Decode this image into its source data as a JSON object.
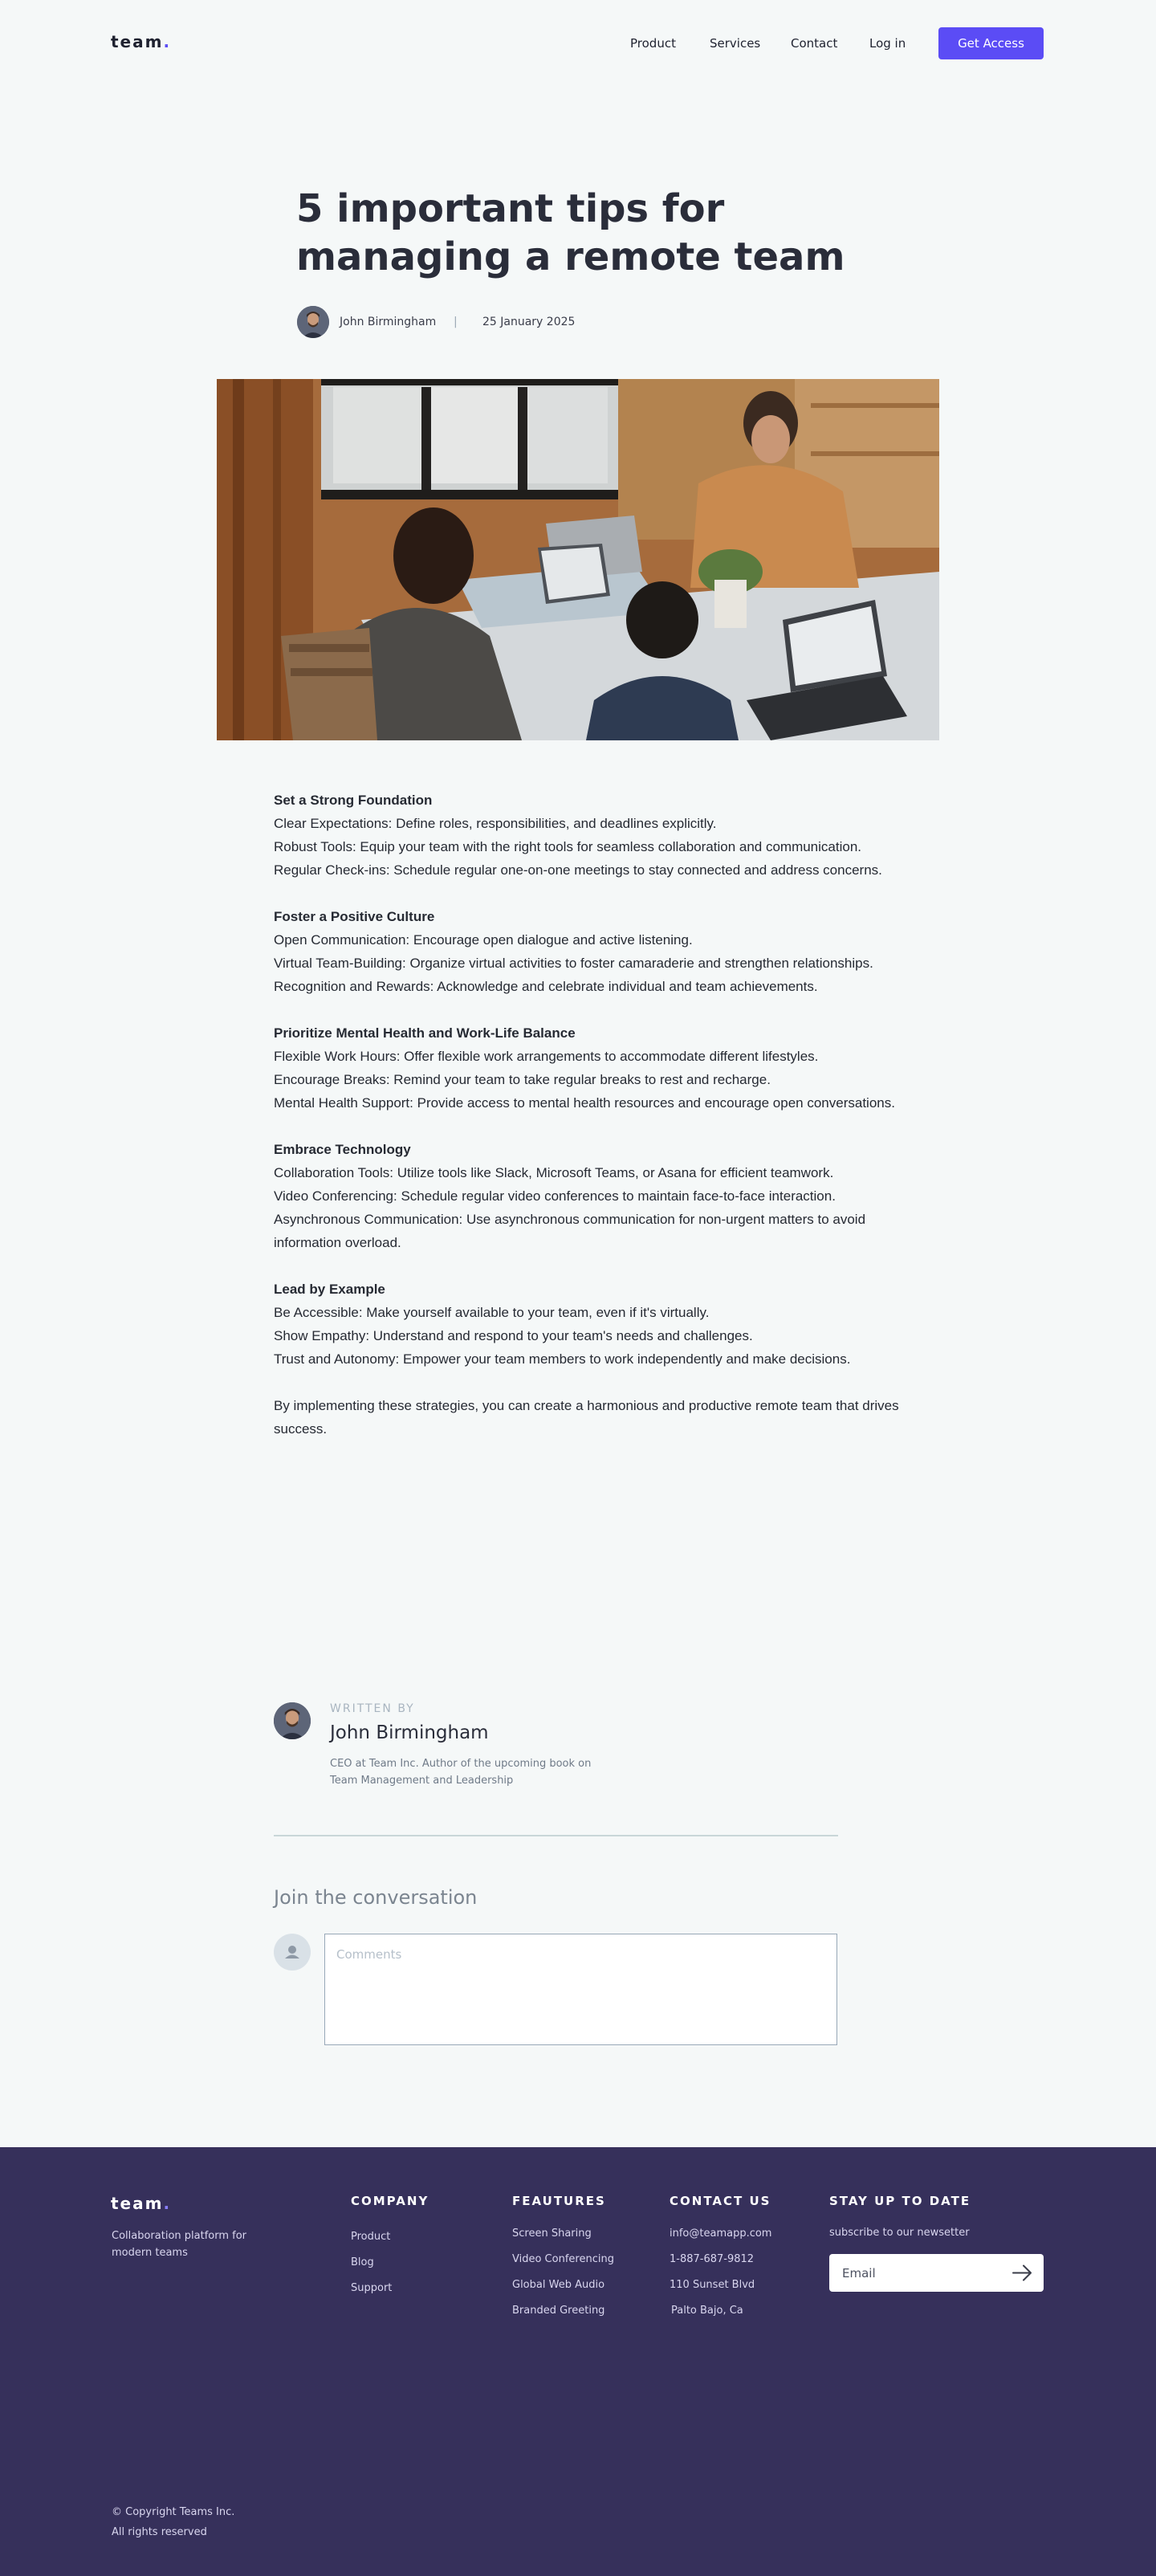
{
  "header": {
    "logo": "team",
    "logo_dot": ".",
    "nav": [
      "Product",
      "Services",
      "Contact",
      "Log in"
    ],
    "cta": "Get Access"
  },
  "article": {
    "title": "5 important tips for managing a remote team",
    "author": "John Birmingham",
    "separator": "|",
    "date": "25 January 2025",
    "sections": [
      {
        "heading": "Set a Strong Foundation",
        "items": [
          "Clear Expectations: Define roles, responsibilities, and deadlines explicitly.",
          "Robust Tools: Equip your team with the right tools for seamless collaboration and communication.",
          "Regular Check-ins: Schedule regular one-on-one meetings to stay connected and address concerns."
        ]
      },
      {
        "heading": "Foster a Positive Culture",
        "items": [
          "Open Communication: Encourage open dialogue and active listening.",
          "Virtual Team-Building: Organize virtual activities to foster camaraderie and strengthen relationships.",
          "Recognition and Rewards: Acknowledge and celebrate individual and team achievements."
        ]
      },
      {
        "heading": "Prioritize Mental Health and Work-Life Balance",
        "items": [
          "Flexible Work Hours: Offer flexible work arrangements to accommodate different lifestyles.",
          "Encourage Breaks: Remind your team to take regular breaks to rest and recharge.",
          "Mental Health Support: Provide access to mental health resources and encourage open conversations."
        ]
      },
      {
        "heading": "Embrace Technology",
        "items": [
          "Collaboration Tools: Utilize tools like Slack, Microsoft Teams, or Asana for efficient teamwork.",
          "Video Conferencing: Schedule regular video conferences to maintain face-to-face interaction.",
          "Asynchronous Communication: Use asynchronous communication for non-urgent matters to avoid information overload."
        ]
      },
      {
        "heading": "Lead by Example",
        "items": [
          "Be Accessible: Make yourself available to your team, even if it's virtually.",
          "Show Empathy: Understand and respond to your team's needs and challenges.",
          "Trust and Autonomy: Empower your team members to work independently and make decisions."
        ]
      }
    ],
    "closing": "By implementing these strategies, you can create a harmonious and productive remote team that drives success."
  },
  "author_box": {
    "label": "WRITTEN BY",
    "name": "John Birmingham",
    "bio": "CEO at Team Inc. Author of the upcoming book on Team Management and Leadership"
  },
  "comments": {
    "heading": "Join the conversation",
    "placeholder": "Comments"
  },
  "footer": {
    "logo": "team",
    "logo_dot": ".",
    "tagline": "Collaboration platform for modern teams",
    "company": {
      "heading": "COMPANY",
      "links": [
        "Product",
        "Blog",
        "Support"
      ]
    },
    "features": {
      "heading": "FEAUTURES",
      "links": [
        "Screen Sharing",
        "Video Conferencing",
        "Global Web Audio",
        "Branded Greeting"
      ]
    },
    "contact": {
      "heading": "CONTACT US",
      "lines": [
        "info@teamapp.com",
        "1-887-687-9812",
        "110 Sunset Blvd",
        "Palto Bajo, Ca"
      ]
    },
    "newsletter": {
      "heading": "STAY UP TO DATE",
      "text": "subscribe to our newsetter",
      "placeholder": "Email"
    },
    "copyright": [
      "© Copyright Teams Inc.",
      "All rights reserved"
    ]
  },
  "colors": {
    "accent": "#5b4cf5",
    "footer_bg": "#36305b",
    "page_bg": "#f5f8f8"
  }
}
